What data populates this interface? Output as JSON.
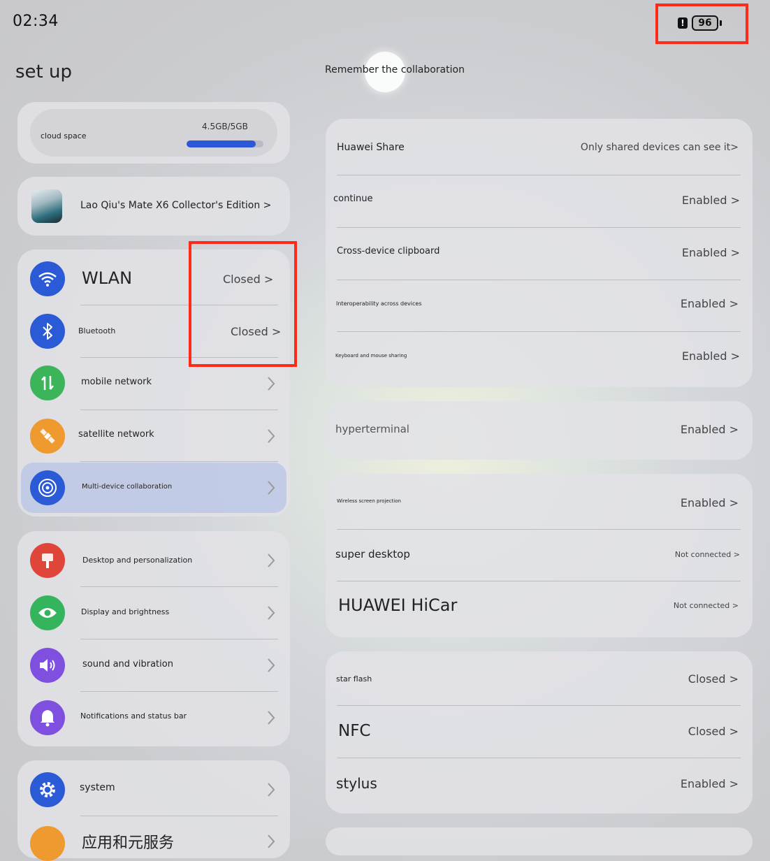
{
  "status_bar": {
    "time": "02:34",
    "alert": "!",
    "battery": "96"
  },
  "page_title": "set up",
  "right_heading": "Remember the collaboration",
  "cloud": {
    "label": "cloud space",
    "value": "4.5GB/5GB",
    "used_fraction": 0.9
  },
  "device": {
    "label": "Lao Qiu's Mate X6 Collector's Edition >"
  },
  "network_items": [
    {
      "label": "WLAN",
      "value": "Closed >",
      "icon": "wifi-icon",
      "color": "#2a5ad6"
    },
    {
      "label": "Bluetooth",
      "value": "Closed >",
      "icon": "bluetooth-icon",
      "color": "#2a5ad6"
    },
    {
      "label": "mobile network",
      "icon": "mobile-data-icon",
      "color": "#3cb45a"
    },
    {
      "label": "satellite network",
      "icon": "satellite-icon",
      "color": "#ee9a2e"
    },
    {
      "label": "Multi-device collaboration",
      "icon": "collaboration-icon",
      "color": "#2a5ad6"
    }
  ],
  "display_items": [
    {
      "label": "Desktop and personalization",
      "icon": "paintbrush-icon",
      "color": "#e0453a"
    },
    {
      "label": "Display and brightness",
      "icon": "eye-icon",
      "color": "#34b45c"
    },
    {
      "label": "sound and vibration",
      "icon": "speaker-icon",
      "color": "#7f4fe0"
    },
    {
      "label": "Notifications and status bar",
      "icon": "bell-icon",
      "color": "#7f4fe0"
    }
  ],
  "system_items": [
    {
      "label": "system",
      "icon": "gear-icon",
      "color": "#2a5ad6"
    },
    {
      "label": "应用和元服务",
      "icon": "apps-icon",
      "color": "#ee9a2e"
    }
  ],
  "share_group": [
    {
      "label": "Huawei Share",
      "value": "Only shared devices can see it>"
    },
    {
      "label": "continue",
      "value": "Enabled >"
    },
    {
      "label": "Cross-device clipboard",
      "value": "Enabled >"
    },
    {
      "label": "Interoperability across devices",
      "value": "Enabled >"
    },
    {
      "label": "Keyboard and mouse sharing",
      "value": "Enabled >"
    }
  ],
  "hyper_group": [
    {
      "label": "hyperterminal",
      "value": "Enabled >"
    }
  ],
  "projection_group": [
    {
      "label": "Wireless screen projection",
      "value": "Enabled >"
    },
    {
      "label": "super desktop",
      "value": "Not connected >"
    },
    {
      "label": "HUAWEI HiCar",
      "value": "Not connected >"
    }
  ],
  "nfc_group": [
    {
      "label": "star flash",
      "value": "Closed >"
    },
    {
      "label": "NFC",
      "value": "Closed >"
    },
    {
      "label": "stylus",
      "value": "Enabled >"
    }
  ],
  "colors": {
    "highlight": "#ff2a1a",
    "progress": "#2d57d9"
  }
}
